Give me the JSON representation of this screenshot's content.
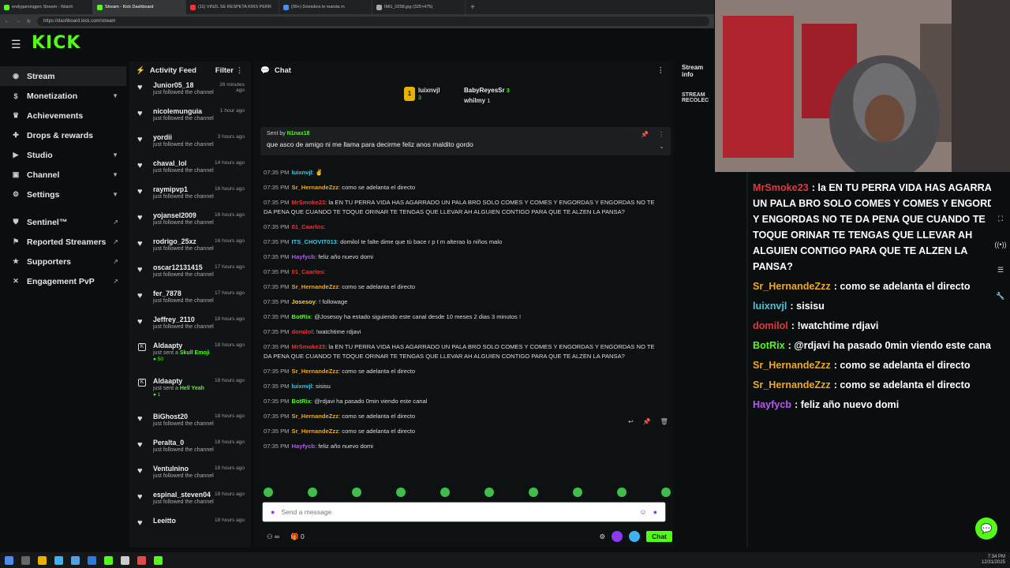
{
  "browser": {
    "tabs": [
      {
        "label": "endygamingpro Stream - Watch",
        "color": "#53fc18"
      },
      {
        "label": "Stream - Kick Dashboard",
        "color": "#53fc18"
      },
      {
        "label": "(11) VINZL SE RESPETA KRIS PERR",
        "color": "#ff2d2d"
      },
      {
        "label": "(99+) Domidios le manda m",
        "color": "#4a8cf0"
      },
      {
        "label": "IMG_0258.jpg (325×475)",
        "color": "#aaaaaa"
      }
    ],
    "new_tab": "+",
    "url": "https://dashboard.kick.com/stream"
  },
  "header": {
    "logo": "KICK",
    "menu_icon": "hamburger-icon"
  },
  "sidebar": {
    "items": [
      {
        "label": "Stream",
        "icon": "broadcast-icon",
        "active": true
      },
      {
        "label": "Monetization",
        "icon": "dollar-icon",
        "chevron": true
      },
      {
        "label": "Achievements",
        "icon": "trophy-icon"
      },
      {
        "label": "Drops & rewards",
        "icon": "gift-icon"
      },
      {
        "label": "Studio",
        "icon": "video-icon",
        "chevron": true
      },
      {
        "label": "Channel",
        "icon": "user-icon",
        "chevron": true
      },
      {
        "label": "Settings",
        "icon": "gear-icon",
        "chevron": true
      }
    ],
    "external": [
      {
        "label": "Sentinel™",
        "icon": "shield-icon"
      },
      {
        "label": "Reported Streamers",
        "icon": "flag-icon"
      },
      {
        "label": "Supporters",
        "icon": "star-icon"
      },
      {
        "label": "Engagement PvP",
        "icon": "swords-icon"
      }
    ]
  },
  "activity": {
    "title": "Activity Feed",
    "filter": "Filter",
    "items": [
      {
        "name": "Junior05_18",
        "time": "26 minutes ago",
        "desc": "just followed the channel",
        "type": "follow"
      },
      {
        "name": "nicolemunguia",
        "time": "1 hour ago",
        "desc": "just followed the channel",
        "type": "follow"
      },
      {
        "name": "yordii",
        "time": "3 hours ago",
        "desc": "just followed the channel",
        "type": "follow"
      },
      {
        "name": "chaval_lol",
        "time": "14 hours ago",
        "desc": "just followed the channel",
        "type": "follow"
      },
      {
        "name": "raymipvp1",
        "time": "16 hours ago",
        "desc": "just followed the channel",
        "type": "follow"
      },
      {
        "name": "yojansel2009",
        "time": "16 hours ago",
        "desc": "just followed the channel",
        "type": "follow"
      },
      {
        "name": "rodrigo_25xz",
        "time": "16 hours ago",
        "desc": "just followed the channel",
        "type": "follow"
      },
      {
        "name": "oscar12131415",
        "time": "17 hours ago",
        "desc": "just followed the channel",
        "type": "follow"
      },
      {
        "name": "fer_7878",
        "time": "17 hours ago",
        "desc": "just followed the channel",
        "type": "follow"
      },
      {
        "name": "Jeffrey_2110",
        "time": "18 hours ago",
        "desc": "just followed the channel",
        "type": "follow"
      },
      {
        "name": "Aldaapty",
        "time": "18 hours ago",
        "desc": "just sent a",
        "emote": "Skull Emoji",
        "gift": "50",
        "type": "gift"
      },
      {
        "name": "Aldaapty",
        "time": "18 hours ago",
        "desc": "just sent a",
        "emote": "Hell Yeah",
        "gift": "1",
        "type": "gift"
      },
      {
        "name": "BiGhost20",
        "time": "18 hours ago",
        "desc": "just followed the channel",
        "type": "follow"
      },
      {
        "name": "Peralta_0",
        "time": "18 hours ago",
        "desc": "just followed the channel",
        "type": "follow"
      },
      {
        "name": "Ventulnino",
        "time": "18 hours ago",
        "desc": "just followed the channel",
        "type": "follow"
      },
      {
        "name": "espinal_steven04",
        "time": "18 hours ago",
        "desc": "just followed the channel",
        "type": "follow"
      },
      {
        "name": "Leeitto",
        "time": "18 hours ago",
        "desc": "",
        "type": "follow"
      }
    ]
  },
  "chat": {
    "title": "Chat",
    "leaderboard": [
      {
        "name": "luixnvjl",
        "count": "3"
      },
      {
        "name": "BabyReyesSr",
        "count": "3"
      },
      {
        "name": "whilmy",
        "count": "1"
      }
    ],
    "pinned": {
      "by_label": "Sent by",
      "by_user": "N1nax18",
      "message": "que asco de amigo ni me llama para decirme feliz anos maldito gordo"
    },
    "messages": [
      {
        "time": "07:35 PM",
        "user": "luixnvjl",
        "color": "c-cyan",
        "text": "✌"
      },
      {
        "time": "07:35 PM",
        "user": "Sr_HernandeZzz",
        "color": "c-orange",
        "text": "como se adelanta el directo"
      },
      {
        "time": "07:35 PM",
        "user": "MrSmoke23",
        "color": "c-red",
        "text": "la EN TU PERRA VIDA HAS AGARRADO UN PALA BRO SOLO COMES Y COMES Y ENGORDAS Y ENGORDAS NO TE DA PENA QUE CUANDO TE TOQUE ORINAR TE TENGAS QUE LLEVAR AH ALGUIEN CONTIGO PARA QUE TE ALZEN LA PANSA?"
      },
      {
        "time": "07:35 PM",
        "user": "01_Caarlos",
        "color": "c-red",
        "text": ""
      },
      {
        "time": "07:35 PM",
        "user": "ITS_CHOVIT013",
        "color": "c-cyan",
        "text": "domilol te falte dime que tú bace r p t m  alterao lo niños malo"
      },
      {
        "time": "07:35 PM",
        "user": "Hayfycb",
        "color": "c-purple",
        "text": "feliz año nuevo domi"
      },
      {
        "time": "07:35 PM",
        "user": "01_Caarlos",
        "color": "c-red",
        "text": ""
      },
      {
        "time": "07:35 PM",
        "user": "Sr_HernandeZzz",
        "color": "c-orange",
        "text": "como se adelanta el directo"
      },
      {
        "time": "07:35 PM",
        "user": "Josesoy",
        "color": "c-yellow",
        "text": "! followage"
      },
      {
        "time": "07:35 PM",
        "user": "BotRix",
        "color": "c-green",
        "text": "@Josesoy ha estado siguiendo este canal desde 10 meses 2  dias 3 minutos !"
      },
      {
        "time": "07:35 PM",
        "user": "domilol",
        "color": "c-red",
        "text": "!watchtime rdjavi"
      },
      {
        "time": "07:35 PM",
        "user": "MrSmoke23",
        "color": "c-red",
        "text": "la EN TU PERRA VIDA HAS AGARRADO UN PALA BRO SOLO COMES Y COMES Y ENGORDAS Y ENGORDAS NO TE DA PENA QUE CUANDO TE TOQUE ORINAR TE TENGAS QUE LLEVAR AH ALGUIEN CONTIGO PARA QUE TE ALZEN LA PANSA?"
      },
      {
        "time": "07:35 PM",
        "user": "Sr_HernandeZzz",
        "color": "c-orange",
        "text": "como se adelanta el directo"
      },
      {
        "time": "07:35 PM",
        "user": "luixnvjl",
        "color": "c-cyan",
        "text": "sisisu"
      },
      {
        "time": "07:35 PM",
        "user": "BotRix",
        "color": "c-green",
        "text": "@rdjavi ha pasado 0min viendo este canal"
      },
      {
        "time": "07:35 PM",
        "user": "Sr_HernandeZzz",
        "color": "c-orange",
        "text": "como se adelanta el directo"
      },
      {
        "time": "07:35 PM",
        "user": "Sr_HernandeZzz",
        "color": "c-orange",
        "text": "como se adelanta el directo"
      },
      {
        "time": "07:35 PM",
        "user": "Hayfycb",
        "color": "c-purple",
        "text": "feliz año nuevo domi"
      }
    ],
    "input_placeholder": "Send a message",
    "footer_count": "0",
    "send_label": "Chat"
  },
  "stream_info": {
    "title": "Stream info",
    "sub": "STREAM RECOLEC"
  },
  "overlay_chat": {
    "messages": [
      {
        "user": "MrSmoke23",
        "color": "c-red",
        "text": "la EN TU PERRA VIDA HAS AGARRADO UN PALA BRO SOLO COMES Y COMES Y ENGORDAS Y ENGORDAS NO TE DA PENA QUE CUANDO TE TOQUE ORINAR TE TENGAS QUE LLEVAR AH ALGUIEN CONTIGO PARA QUE TE ALZEN LA PANSA?"
      },
      {
        "user": "Sr_HernandeZzz",
        "color": "c-orange",
        "text": "como se adelanta el directo"
      },
      {
        "user": "luixnvjl",
        "color": "c-cyan",
        "text": "sisisu"
      },
      {
        "user": "domilol",
        "color": "c-red",
        "text": "!watchtime rdjavi"
      },
      {
        "user": "BotRix",
        "color": "c-green",
        "text": "@rdjavi ha pasado 0min viendo este canal"
      },
      {
        "user": "Sr_HernandeZzz",
        "color": "c-orange",
        "text": "como se adelanta el directo"
      },
      {
        "user": "Sr_HernandeZzz",
        "color": "c-orange",
        "text": "como se adelanta el directo"
      },
      {
        "user": "Hayfycb",
        "color": "c-purple",
        "text": "feliz año nuevo domi"
      }
    ]
  },
  "taskbar": {
    "time": "7:34 PM",
    "date": "12/31/2025"
  }
}
